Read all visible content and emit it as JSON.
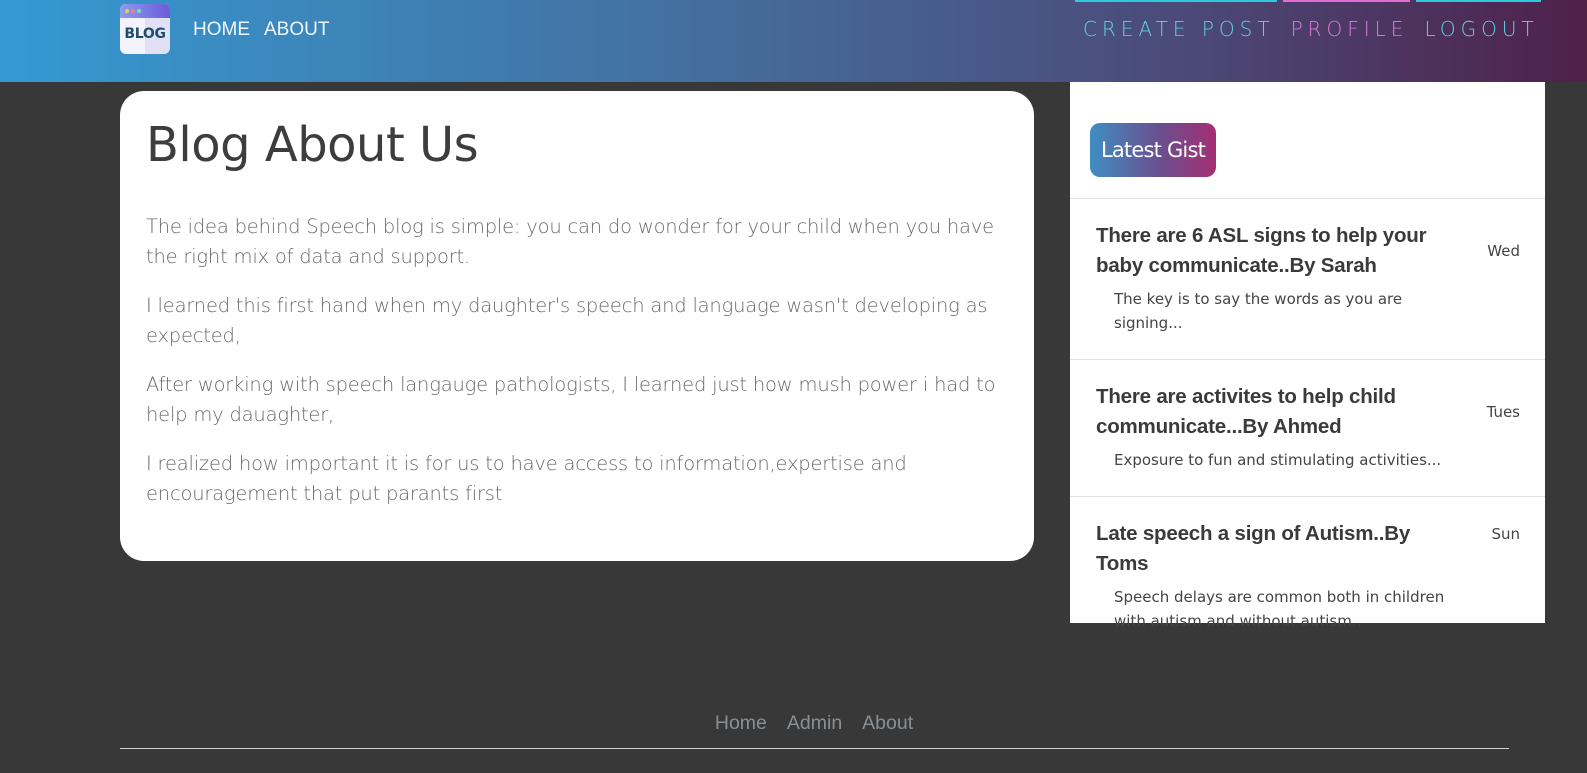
{
  "header": {
    "logo_text": "BLOG",
    "nav_left": [
      "HOME",
      "ABOUT"
    ],
    "nav_right": [
      {
        "label": "CREATE POST",
        "color": "#5fd3e3",
        "line": "#2ec8df"
      },
      {
        "label": "PROFILE",
        "color": "#e07ad8",
        "line": "#e36bd6"
      },
      {
        "label": "LOGOUT",
        "color": "#5fd3e3",
        "line": "#2ec8df"
      }
    ]
  },
  "main": {
    "title": "Blog About Us",
    "paragraphs": [
      "The idea behind Speech blog is simple: you can do wonder for your child when you have the right mix of data and support.",
      "I learned this first hand when my daughter's speech and language wasn't developing as expected,",
      "After working with speech langauge pathologists, I learned just how mush power i had to help my dauaghter,",
      "I realized how important it is for us to have access to information,expertise and encouragement that put parants first"
    ]
  },
  "sidebar": {
    "badge": "Latest Gist",
    "items": [
      {
        "title": "There are 6 ASL signs to help your baby communicate..By Sarah",
        "desc": "The key is to say the words as you are signing...",
        "day": "Wed"
      },
      {
        "title": "There are activites to help child communicate...By Ahmed",
        "desc": "Exposure to fun and stimulating activities...",
        "day": "Tues"
      },
      {
        "title": "Late speech a sign of Autism..By Toms",
        "desc": "Speech delays are common both in children with autism and without autism..",
        "day": "Sun"
      }
    ]
  },
  "footer": {
    "links": [
      "Home",
      "Admin",
      "About"
    ]
  }
}
